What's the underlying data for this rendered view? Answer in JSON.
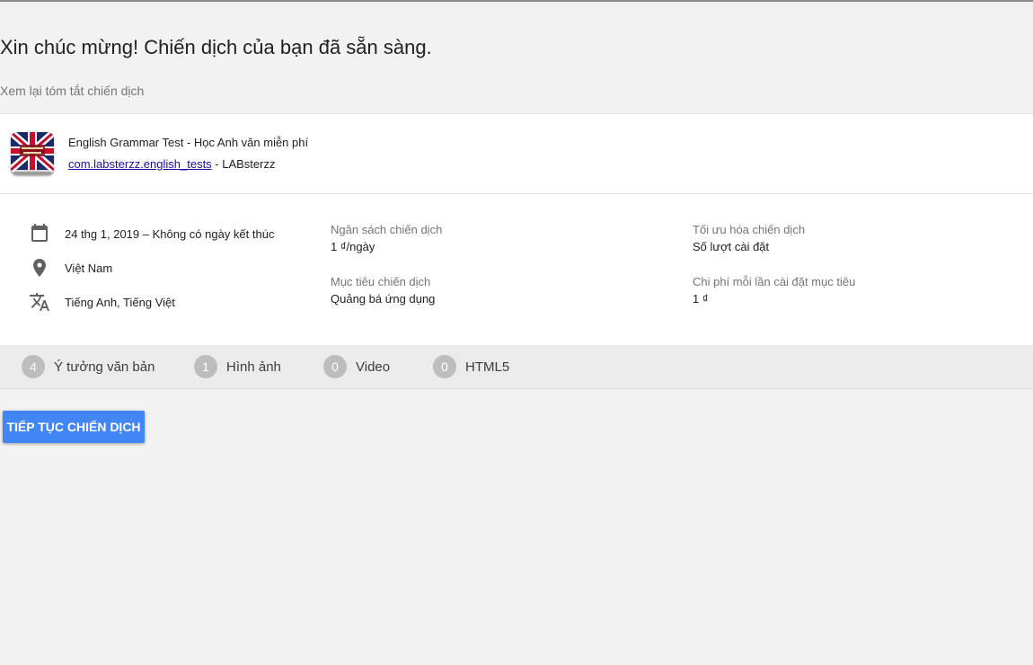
{
  "header": {
    "title": "Xin chúc mừng! Chiến dịch của bạn đã sẵn sàng.",
    "subtitle": "Xem lại tóm tắt chiến dịch"
  },
  "app": {
    "icon": "union-jack-book-icon",
    "name": "English Grammar Test - Học Anh văn miễn phí",
    "package_link": "com.labsterzz.english_tests",
    "developer_suffix": " - LABsterzz"
  },
  "details": {
    "date": {
      "icon": "calendar-icon",
      "text": "24 thg 1, 2019 – Không có ngày kết thúc"
    },
    "location": {
      "icon": "location-pin-icon",
      "text": "Việt Nam"
    },
    "languages": {
      "icon": "translate-icon",
      "text": "Tiếng Anh, Tiếng Việt"
    },
    "budget": {
      "label": "Ngân sách chiến dịch",
      "value": "1 ₫/ngày"
    },
    "goal": {
      "label": "Mục tiêu chiến dịch",
      "value": "Quảng bá ứng dụng"
    },
    "optimization": {
      "label": "Tối ưu hóa chiến dịch",
      "value": "Số lượt cài đặt"
    },
    "cost_per_install": {
      "label": "Chi phí mỗi lần cài đặt mục tiêu",
      "value": "1 ₫"
    }
  },
  "assets": [
    {
      "count": "4",
      "label": "Ý tưởng văn bản"
    },
    {
      "count": "1",
      "label": "Hình ảnh"
    },
    {
      "count": "0",
      "label": "Video"
    },
    {
      "count": "0",
      "label": "HTML5"
    }
  ],
  "actions": {
    "continue_label": "TIẾP TỤC CHIẾN DỊCH"
  },
  "colors": {
    "primary_button": "#4285f4",
    "link": "#1a0dab",
    "count_badge": "#bdbdbd"
  }
}
